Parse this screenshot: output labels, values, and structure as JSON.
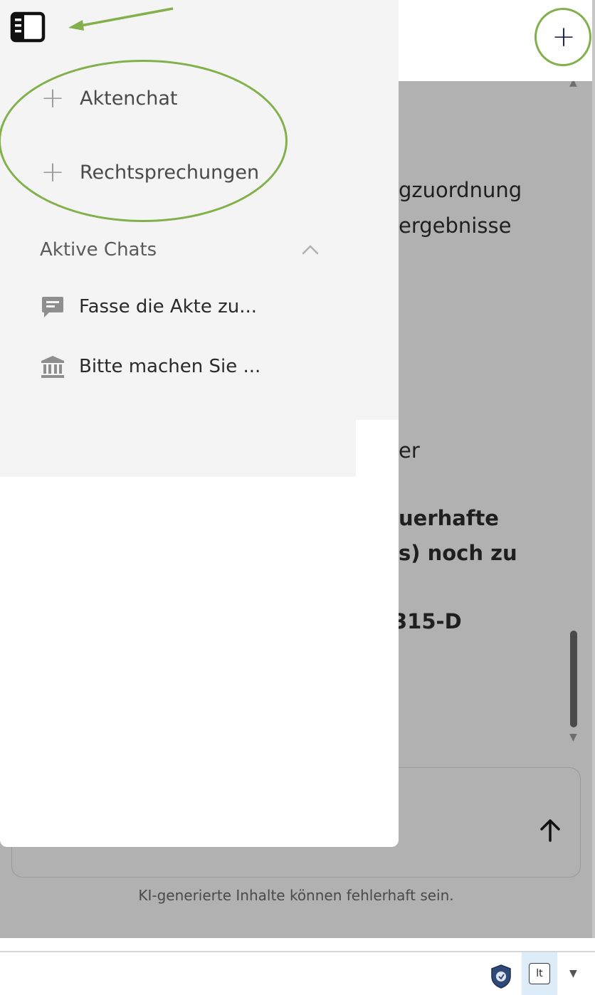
{
  "main": {
    "new_chat_symbol": "+",
    "message_fragments": [
      {
        "text": "gzuordnung",
        "bold": false
      },
      {
        "text": "ergebnisse",
        "bold": false
      },
      {
        "text": "er",
        "bold": false
      },
      {
        "text": "uerhafte",
        "bold": true
      },
      {
        "text": "s) noch zu",
        "bold": false
      },
      {
        "text": "315-D",
        "bold": true
      }
    ],
    "disclaimer": "KI-generierte Inhalte können fehlerhaft sein."
  },
  "sidebar": {
    "new_items": [
      {
        "label": "Aktenchat",
        "icon": "plus-icon"
      },
      {
        "label": "Rechtsprechungen",
        "icon": "plus-icon"
      }
    ],
    "active_chats_label": "Aktive Chats",
    "chats": [
      {
        "label": "Fasse die Akte zu...",
        "icon": "chat-bubble-icon"
      },
      {
        "label": "Bitte machen Sie ...",
        "icon": "courthouse-icon"
      }
    ]
  },
  "statusbar": {
    "lt_label": "lt"
  },
  "colors": {
    "annotation_green": "#82b14b",
    "overlay_gray": "#b1b1b1",
    "sidebar_bg": "#f4f4f4"
  }
}
